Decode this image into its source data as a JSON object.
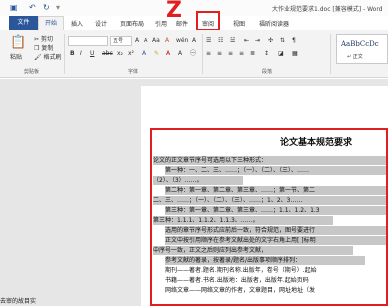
{
  "window": {
    "title": "大作业规范要求1.doc [兼容模式] - Word"
  },
  "quick_access": {
    "save_icon": "save-icon",
    "undo_icon": "undo-icon",
    "redo_icon": "redo-icon",
    "save_label": "▣",
    "undo_label": "↶",
    "redo_label": "↻"
  },
  "tabs": [
    {
      "label": "文件"
    },
    {
      "label": "开始"
    },
    {
      "label": "插入"
    },
    {
      "label": "设计"
    },
    {
      "label": "页面布局"
    },
    {
      "label": "引用"
    },
    {
      "label": "邮件"
    },
    {
      "label": "审阅"
    },
    {
      "label": "视图"
    },
    {
      "label": "福昕阅读器"
    }
  ],
  "annotation": {
    "letter": "Z",
    "color": "#e02020"
  },
  "clipboard": {
    "paste_label": "粘贴",
    "cut_label": "剪切",
    "copy_label": "复制",
    "format_painter_label": "格式刷",
    "group_label": "剪贴板"
  },
  "font": {
    "size_value": "五号",
    "group_label": "字体",
    "bold": "B",
    "italic": "I",
    "underline": "U",
    "strike": "abc",
    "sub": "x₂",
    "sup": "x²",
    "grow": "A",
    "shrink": "A",
    "case": "Aa",
    "clear": "A"
  },
  "paragraph": {
    "group_label": "段落"
  },
  "styles": {
    "sample": "AaBbCcDc",
    "name": "↵ 正文"
  },
  "document": {
    "heading": "论文基本规范要求",
    "lines": [
      "论文的正文章节序号可选用以下三种形式：",
      "第一种：一、二、三、……；（一）、（二）、（三）、……",
      "（2）、（3）……。",
      "第二种：第一章、第二章、第三章、……；第一节、第二",
      "二、三、……；（一）、（二）、（三）、……；1、2、3……",
      "第三种：第一章、第二章、第三章、……；1.1、1.2、1.3",
      "第三种：1.1.1、1.1.2、1.1.3、……。",
      "选用的章节序号形式应前后一致，符合规范，图号要进行",
      "正文中按引用顺序在参考文献出处的文字右角上用[ ]标明",
      "中序号一致，正文之后则应列出参考文献，",
      "参考文献的著录，按著录/题名/出版事项顺序排列：",
      "期刊——著者.题名.期刊名称.出版年，卷号（期号）.起始",
      "书籍——著者.书名.出版地：出版者，出版年.起始页码",
      "网络文章——网络文章的作者，文章题目，网址地址（发"
    ]
  },
  "caption": "去审的故目实"
}
